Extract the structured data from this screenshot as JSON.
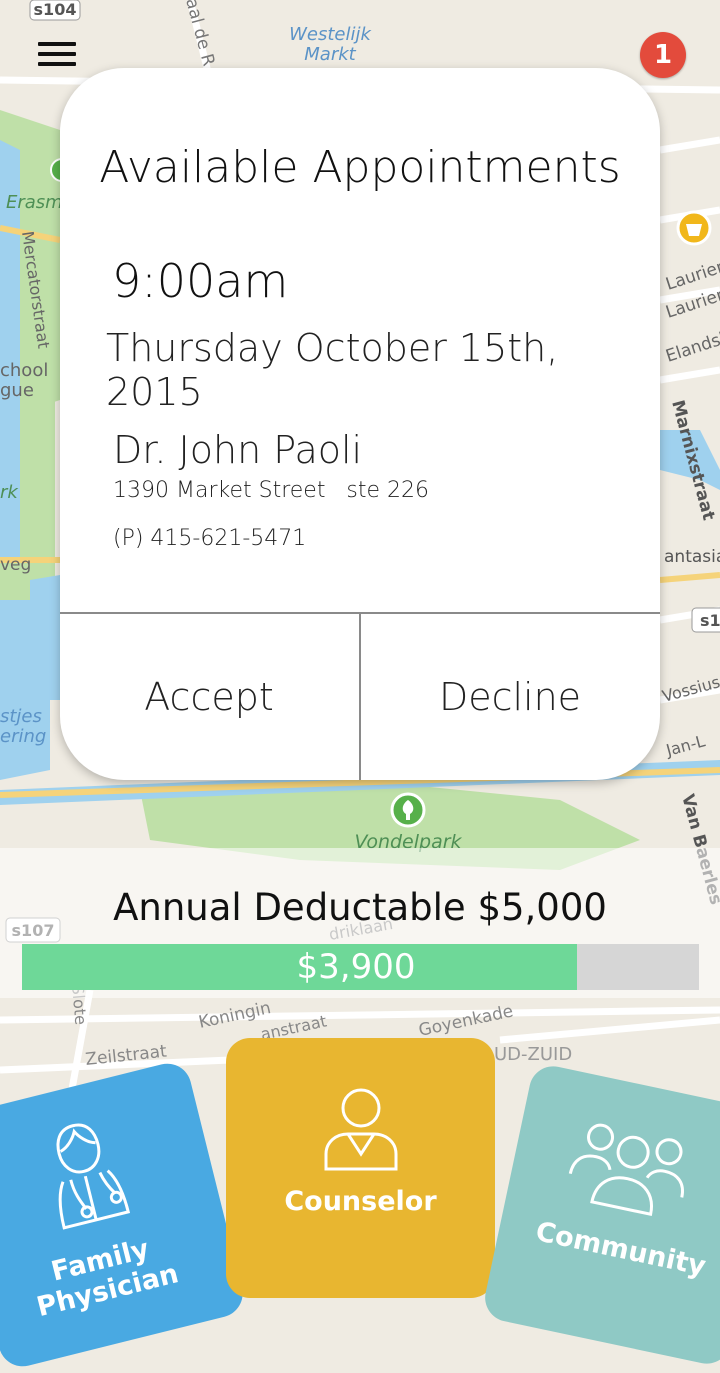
{
  "map": {
    "labels": {
      "road_s104": "s104",
      "westelijk": "Westelijk",
      "markt": "Markt",
      "erasm": "Erasm",
      "mercatorstraat": "Mercatorstraat",
      "chool": "chool",
      "gue": "gue",
      "rk": "rk",
      "veg": "veg",
      "stjes": "stjes",
      "ering": "ering",
      "vondelpark": "Vondelpark",
      "road_s107": "s107",
      "koningin": "Koningin",
      "zeilstraat": "Zeilstraat",
      "slot": "Slote",
      "ud_zuid": "UD-ZUID",
      "goyenkade": "Goyenkade",
      "laurier1": "Laurier",
      "laurier2": "Laurier",
      "elands": "Elandsl",
      "marnixstraat": "Marnixstraat",
      "antasia": "antasia",
      "road_s1": "s1",
      "vossius": "Vossius",
      "janl": "Jan-L",
      "van_baerles": "Van Baerles",
      "de_r": "aal de R",
      "anstraat": "anstraat",
      "driklaan": "driklaan"
    }
  },
  "header": {
    "notification_count": "1"
  },
  "appointment": {
    "title": "Available Appointments",
    "time": "9:00am",
    "date": "Thursday October 15th, 2015",
    "doctor": "Dr. John Paoli",
    "address": "1390 Market Street   ste 226",
    "phone": "(P) 415-621-5471",
    "accept_label": "Accept",
    "decline_label": "Decline"
  },
  "deductible": {
    "title": "Annual Deductable $5,000",
    "paid_label": "$3,900",
    "progress_fraction": 0.82
  },
  "nav": {
    "family_physician": "Family Physician",
    "counselor": "Counselor",
    "community": "Community"
  },
  "colors": {
    "notification": "#e34b3c",
    "progress": "#6ed898",
    "family_physician": "#49a9e2",
    "counselor": "#e8b630",
    "community": "#8fc9c5"
  }
}
